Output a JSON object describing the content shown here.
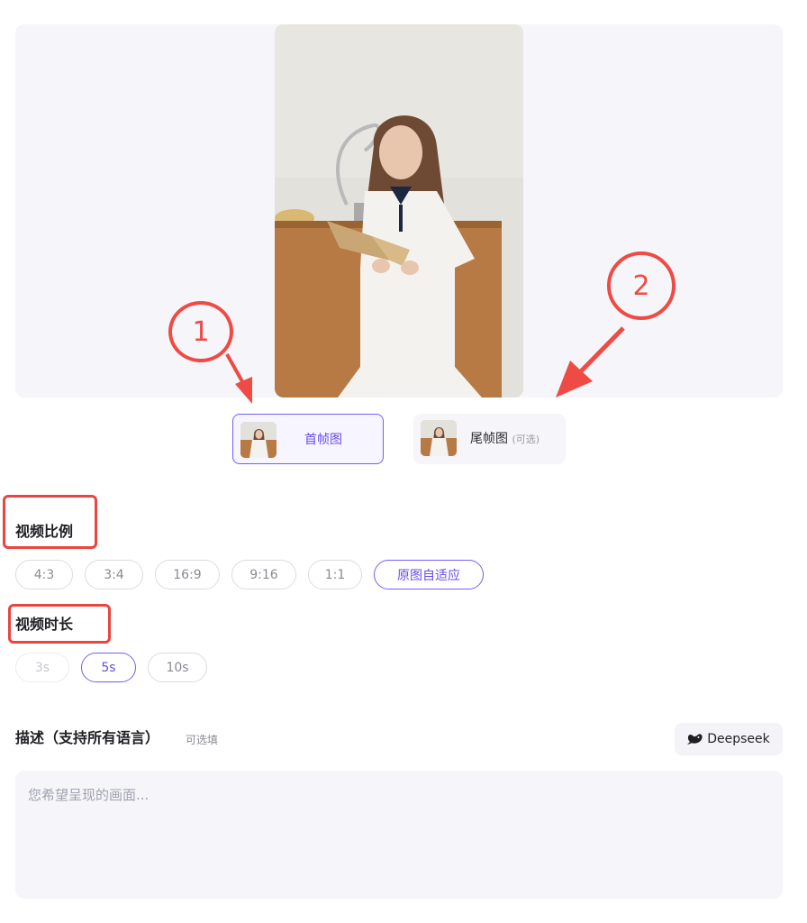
{
  "frames": {
    "first": {
      "label": "首帧图"
    },
    "last": {
      "label": "尾帧图",
      "optional": "(可选)"
    }
  },
  "annotations": {
    "marker1": "1",
    "marker2": "2"
  },
  "aspect_ratio": {
    "title": "视频比例",
    "options": [
      "4:3",
      "3:4",
      "16:9",
      "9:16",
      "1:1",
      "原图自适应"
    ],
    "selected": "原图自适应"
  },
  "duration": {
    "title": "视频时长",
    "options": [
      "3s",
      "5s",
      "10s"
    ],
    "selected": "5s",
    "disabled": [
      "3s"
    ]
  },
  "description": {
    "title": "描述（支持所有语言）",
    "optional_hint": "可选填",
    "placeholder": "您希望呈现的画面...",
    "value": "",
    "deepseek_label": "Deepseek"
  },
  "colors": {
    "accent": "#7b5cf0",
    "annotation": "#ef4b45",
    "panel": "#f5f5fa"
  }
}
